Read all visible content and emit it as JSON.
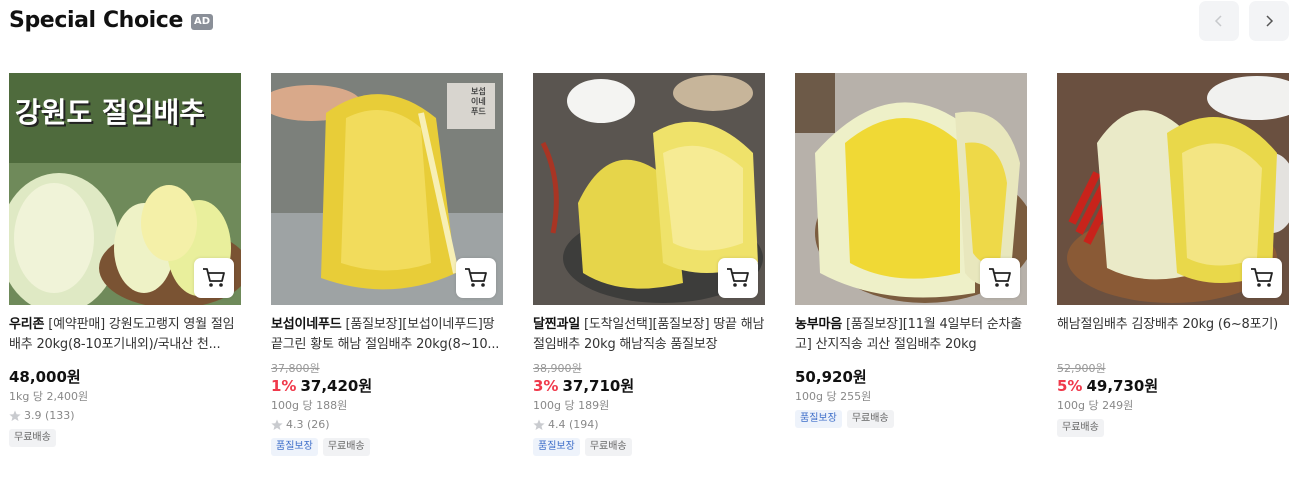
{
  "section": {
    "title": "Special Choice",
    "ad_badge": "AD",
    "prev_icon": "chevron-left-icon",
    "next_icon": "chevron-right-icon"
  },
  "colors": {
    "discount": "#f0394b",
    "quality_tag": "#3d6ec9",
    "badge_bg": "#8a8f98"
  },
  "products": [
    {
      "brand": "우리존",
      "title": "[예약판매] 강원도고랭지 영월 절임배추 20kg(8-10포기내외)/국내산 천...",
      "image_text": "강원도 절임배추",
      "price": "48,000원",
      "unit_price": "1kg 당 2,400원",
      "rating": "3.9",
      "reviews": "(133)",
      "tags": [
        "무료배송"
      ]
    },
    {
      "brand": "보섭이네푸드",
      "title": "[품질보장][보섭이네푸드]땅끝그린 황토 해남 절임배추 20kg(8~10...",
      "image_text": "보섭 이네 푸드",
      "original_price": "37,800원",
      "discount": "1%",
      "price": "37,420원",
      "unit_price": "100g 당 188원",
      "rating": "4.3",
      "reviews": "(26)",
      "tags": [
        "품질보장",
        "무료배송"
      ]
    },
    {
      "brand": "달찐과일",
      "title": "[도착일선택][품질보장] 땅끝 해남 절임배추 20kg 해남직송 품질보장",
      "original_price": "38,900원",
      "discount": "3%",
      "price": "37,710원",
      "unit_price": "100g 당 189원",
      "rating": "4.4",
      "reviews": "(194)",
      "tags": [
        "품질보장",
        "무료배송"
      ]
    },
    {
      "brand": "농부마음",
      "title": "[품질보장][11월 4일부터 순차출고] 산지직송 괴산 절임배추 20kg",
      "price": "50,920원",
      "unit_price": "100g 당 255원",
      "tags": [
        "품질보장",
        "무료배송"
      ]
    },
    {
      "brand": "",
      "title": "해남절임배추 김장배추 20kg (6~8포기)",
      "original_price": "52,900원",
      "discount": "5%",
      "price": "49,730원",
      "unit_price": "100g 당 249원",
      "tags": [
        "무료배송"
      ]
    }
  ]
}
